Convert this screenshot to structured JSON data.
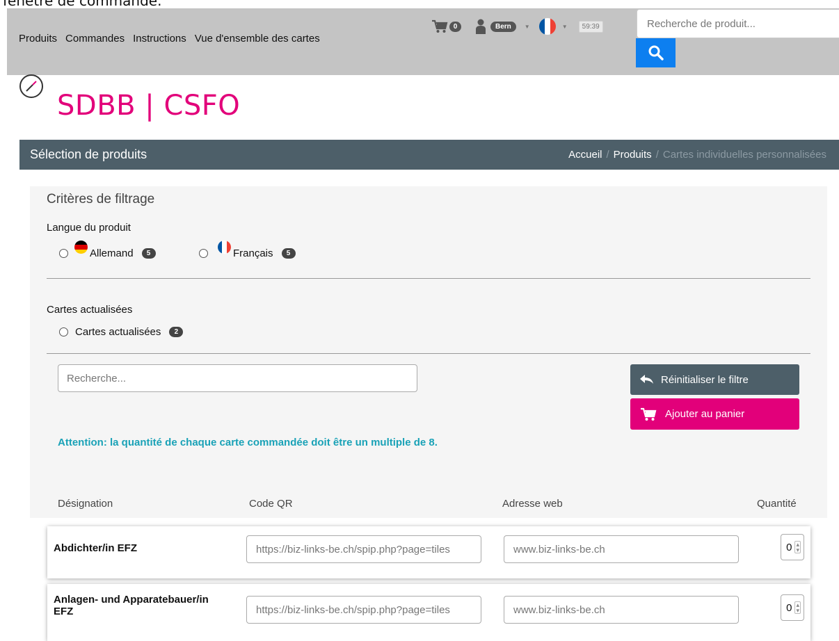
{
  "top_text": "fenêtre de commande.",
  "nav": {
    "links": [
      "Produits",
      "Commandes",
      "Instructions",
      "Vue d'ensemble des cartes"
    ],
    "cart_count": "0",
    "user_badge": "Bern",
    "timer": "59:39",
    "search_placeholder": "Recherche de produit..."
  },
  "logo": {
    "text": "SDBB | CSFO"
  },
  "header": {
    "title": "Sélection de produits",
    "breadcrumb": [
      "Accueil",
      "Produits",
      "Cartes individuelles personnalisées"
    ]
  },
  "filters": {
    "title": "Critères de filtrage",
    "language_label": "Langue du produit",
    "languages": [
      {
        "label": "Allemand",
        "count": "5"
      },
      {
        "label": "Français",
        "count": "5"
      }
    ],
    "updated_label": "Cartes actualisées",
    "updated_option": {
      "label": "Cartes actualisées",
      "count": "2"
    },
    "search_placeholder": "Recherche...",
    "reset_label": "Réinitialiser le filtre",
    "add_cart_label": "Ajouter au panier",
    "notice": "Attention: la quantité de chaque carte commandée doit être un multiple de 8."
  },
  "table": {
    "columns": [
      "Désignation",
      "Code QR",
      "Adresse web",
      "Quantité"
    ],
    "rows": [
      {
        "name": "Abdichter/in EFZ",
        "qr": "https://biz-links-be.ch/spip.php?page=tiles",
        "web": "www.biz-links-be.ch",
        "qty": "0"
      },
      {
        "name": "Anlagen- und Apparatebauer/in EFZ",
        "qr": "https://biz-links-be.ch/spip.php?page=tiles",
        "web": "www.biz-links-be.ch",
        "qty": "0"
      }
    ]
  },
  "colors": {
    "brand_pink": "#e2007a",
    "slate": "#4d5f69",
    "notice_teal": "#1aa2b7",
    "search_blue": "#0d7ff0"
  }
}
